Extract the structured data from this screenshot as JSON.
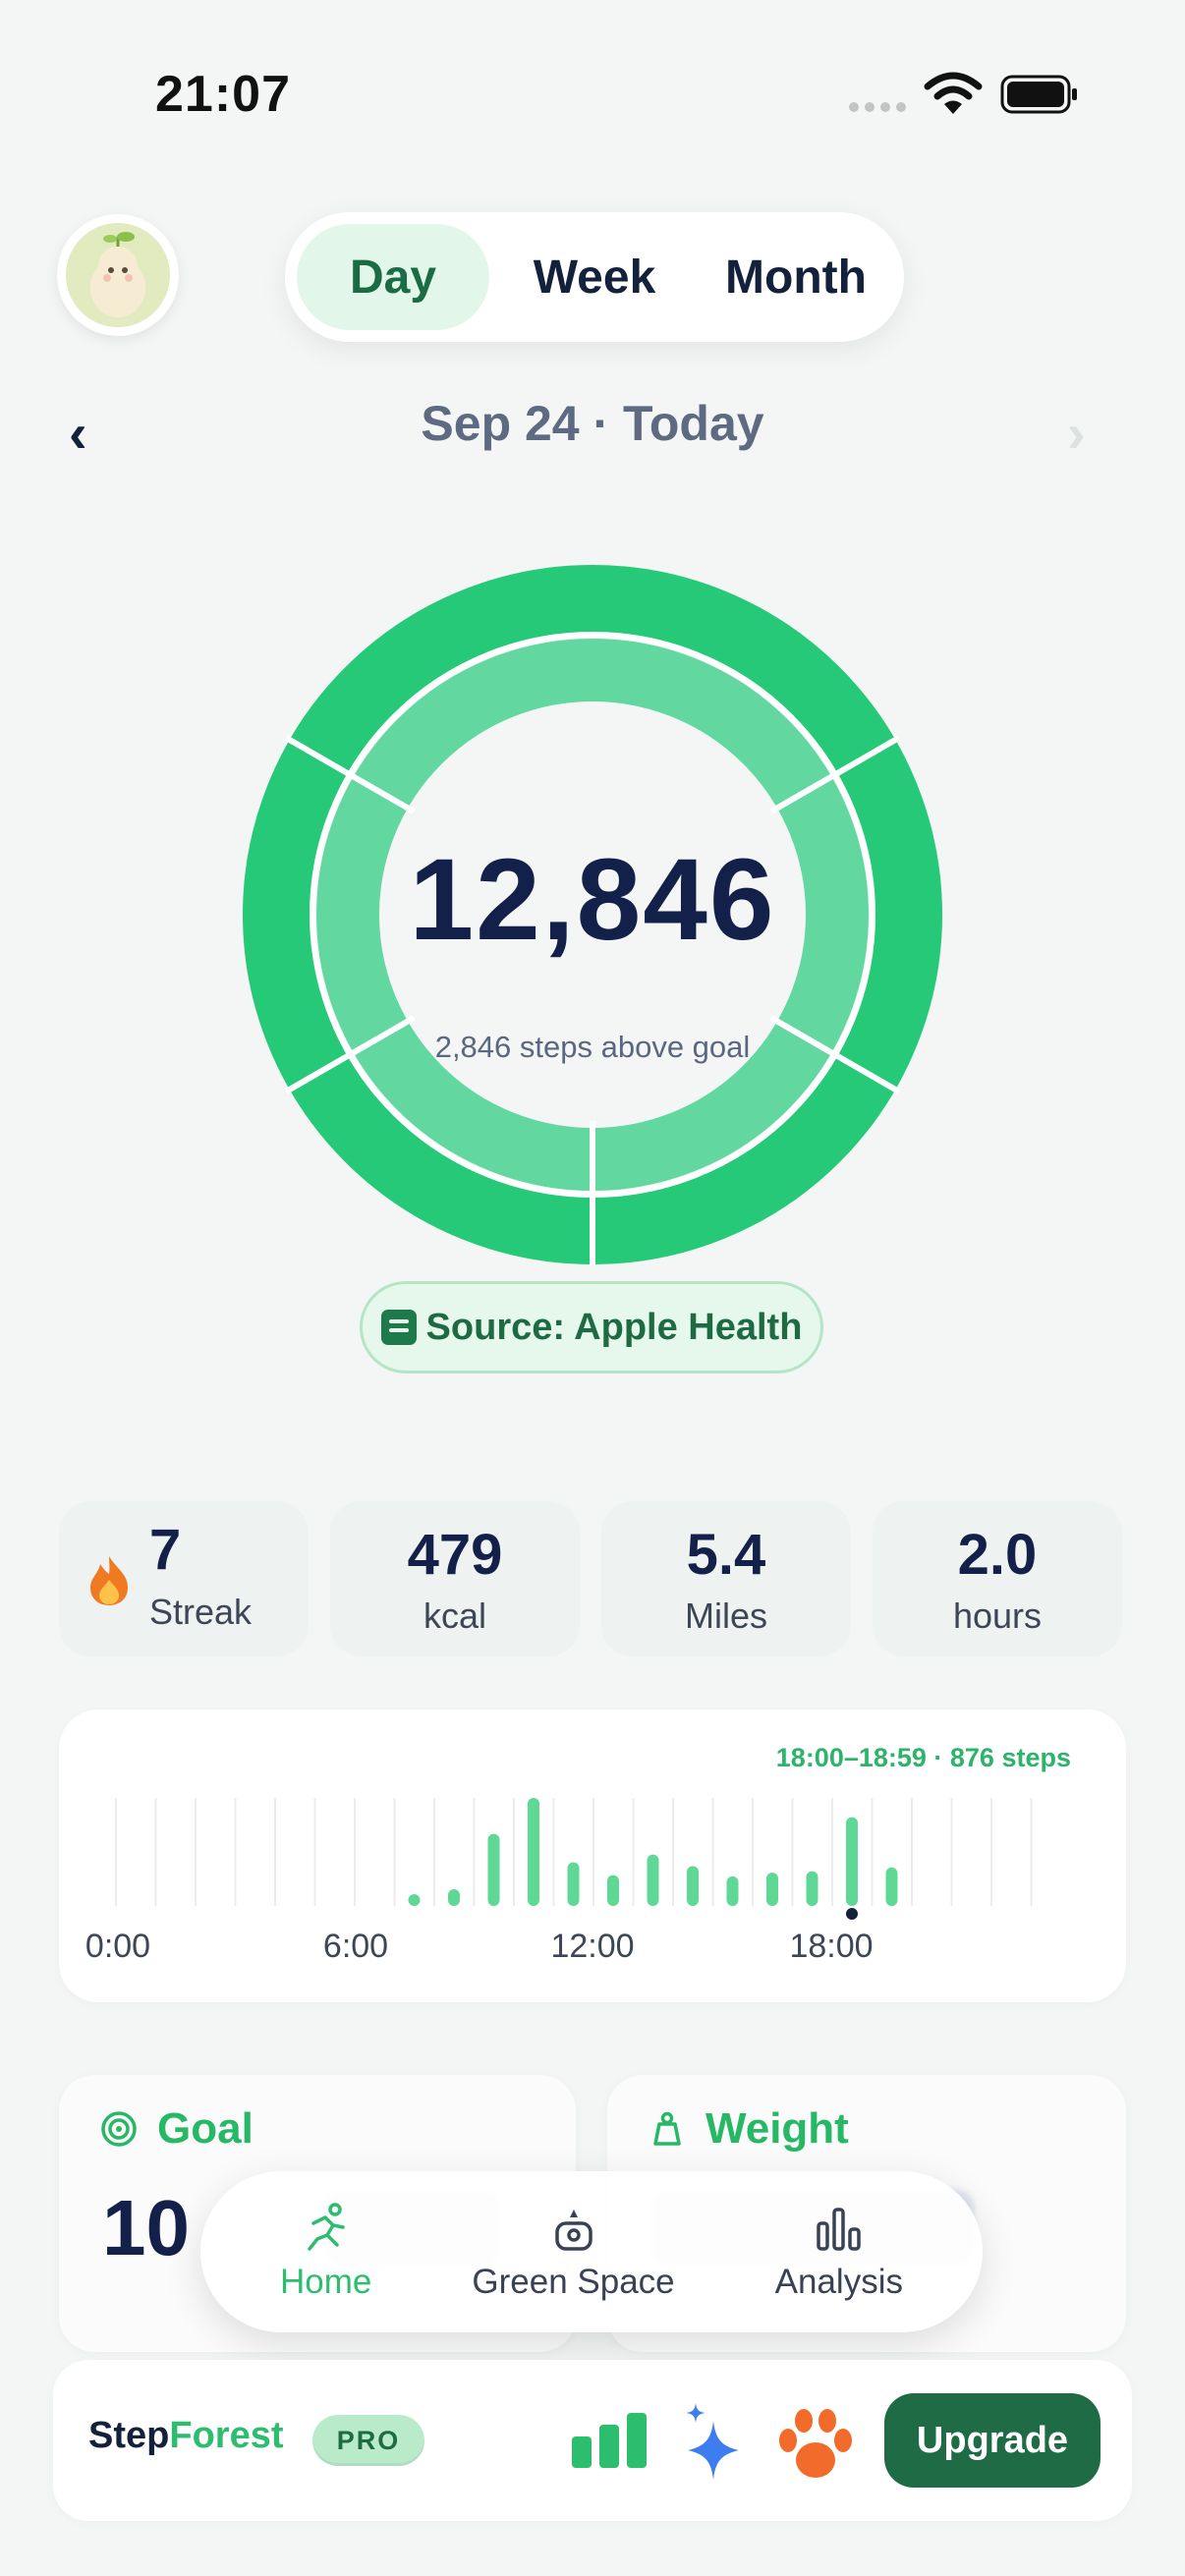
{
  "status_bar": {
    "time": "21:07"
  },
  "header": {
    "tabs": [
      {
        "label": "Day",
        "active": true
      },
      {
        "label": "Week",
        "active": false
      },
      {
        "label": "Month",
        "active": false
      }
    ],
    "date_label": "Sep 24 · Today",
    "prev_icon": "‹",
    "next_icon": "›"
  },
  "summary": {
    "steps": "12,846",
    "subtitle": "2,846 steps above goal",
    "goal_progress": 1.2846,
    "source": "Source: Apple Health"
  },
  "stats": [
    {
      "value": "7",
      "label": "Streak",
      "icon": "fire-icon"
    },
    {
      "value": "479",
      "label": "kcal"
    },
    {
      "value": "5.4",
      "label": "Miles"
    },
    {
      "value": "2.0",
      "label": "hours"
    }
  ],
  "hourly": {
    "selected_label": "18:00–18:59 · 876 steps",
    "selected_hour": 18,
    "x_labels": [
      "0:00",
      "6:00",
      "12:00",
      "18:00"
    ],
    "values": [
      0,
      0,
      0,
      0,
      0,
      0,
      0,
      90,
      130,
      560,
      840,
      340,
      240,
      400,
      310,
      230,
      260,
      270,
      690,
      300,
      0,
      0,
      0,
      0
    ],
    "colors": {
      "bar": "#5fd896",
      "grid": "#ececec",
      "marker": "#14213d"
    }
  },
  "cards": {
    "goal": {
      "title": "Goal",
      "value": "10",
      "icon": "target-icon"
    },
    "weight": {
      "title": "Weight",
      "icon": "scale-icon"
    }
  },
  "nav": {
    "items": [
      {
        "label": "Home",
        "icon": "running-icon",
        "active": true
      },
      {
        "label": "Green Space",
        "icon": "map-icon",
        "active": false
      },
      {
        "label": "Analysis",
        "icon": "bar-chart-icon",
        "active": false
      }
    ]
  },
  "banner": {
    "brand_part1": "Step",
    "brand_part2": "Forest",
    "badge": "PRO",
    "upgrade_label": "Upgrade"
  },
  "colors": {
    "accent_green": "#2dbd6e",
    "dark_green": "#1e6b46",
    "ring_outer": "#25c978",
    "ring_inner": "#62d8a0",
    "navy": "#13214a"
  }
}
